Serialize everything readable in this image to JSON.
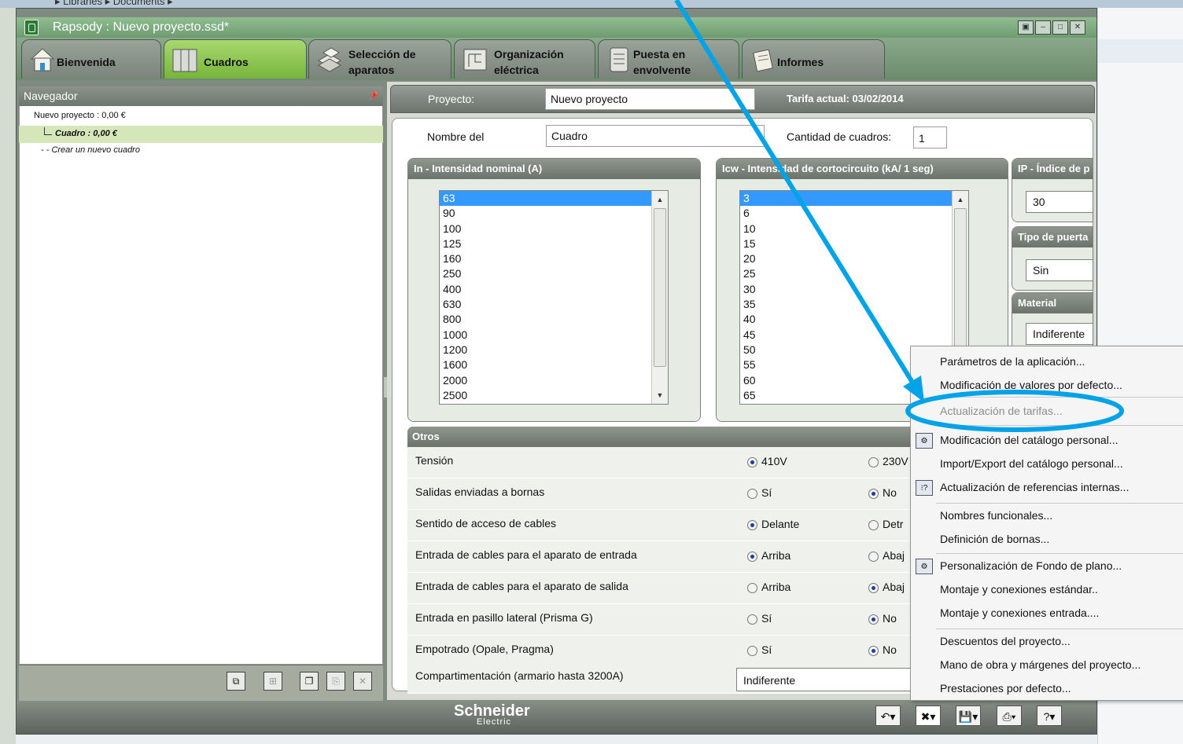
{
  "explorer_breadcrumb": "▸ Libraries ▸ Documents ▸",
  "window": {
    "title": "Rapsody : Nuevo proyecto.ssd*",
    "controls": [
      "restore",
      "minimize",
      "maximize",
      "close"
    ]
  },
  "tabs": [
    {
      "label": "Bienvenida",
      "icon": "house-icon"
    },
    {
      "label": "Cuadros",
      "icon": "cabinet-icon",
      "active": true
    },
    {
      "label1": "Selección de",
      "label2": "aparatos",
      "icon": "devices-icon"
    },
    {
      "label1": "Organización",
      "label2": "eléctrica",
      "icon": "electrical-org-icon"
    },
    {
      "label1": "Puesta en",
      "label2": "envolvente",
      "icon": "enclosure-icon"
    },
    {
      "label": "Informes",
      "icon": "reports-icon"
    }
  ],
  "navigator": {
    "header": "Navegador",
    "project": "Nuevo proyecto : 0,00 €",
    "cuadro": "Cuadro : 0,00 €",
    "new_cuadro": "Crear un nuevo cuadro"
  },
  "project_bar": {
    "label": "Proyecto:",
    "value": "Nuevo proyecto",
    "tariff": "Tarifa actual: 03/02/2014"
  },
  "form": {
    "name_label": "Nombre del",
    "name_value": "Cuadro",
    "qty_label": "Cantidad de cuadros:",
    "qty_value": "1"
  },
  "in_group": {
    "title": "In - Intensidad nominal (A)",
    "values": [
      "63",
      "90",
      "100",
      "125",
      "160",
      "250",
      "400",
      "630",
      "800",
      "1000",
      "1200",
      "1600",
      "2000",
      "2500"
    ],
    "selected": "63"
  },
  "icw_group": {
    "title": "Icw - Intensidad de cortocircuito (kA/ 1 seg)",
    "values": [
      "3",
      "6",
      "10",
      "15",
      "20",
      "25",
      "30",
      "35",
      "40",
      "45",
      "50",
      "55",
      "60",
      "65"
    ],
    "selected": "3"
  },
  "ip_group": {
    "title": "IP - Índice de p",
    "value": "30"
  },
  "door_group": {
    "title": "Tipo de puerta",
    "value": "Sin"
  },
  "material_group": {
    "title": "Material",
    "value": "Indiferente"
  },
  "otros": {
    "title": "Otros",
    "rows": [
      {
        "label": "Tensión",
        "opt1": "410V",
        "opt2": "230V",
        "selected": 1
      },
      {
        "label": "Salidas enviadas a bornas",
        "opt1": "Sí",
        "opt2": "No",
        "selected": 2
      },
      {
        "label": "Sentido de acceso de cables",
        "opt1": "Delante",
        "opt2": "Detr",
        "selected": 1
      },
      {
        "label": "Entrada de cables para el aparato de entrada",
        "opt1": "Arriba",
        "opt2": "Abaj",
        "selected": 1
      },
      {
        "label": "Entrada de cables para el aparato de salida",
        "opt1": "Arriba",
        "opt2": "Abaj",
        "selected": 2
      },
      {
        "label": "Entrada en pasillo lateral (Prisma G)",
        "opt1": "Sí",
        "opt2": "No",
        "selected": 2
      },
      {
        "label": "Empotrado (Opale, Pragma)",
        "opt1": "Sí",
        "opt2": "No",
        "selected": 2
      }
    ],
    "compart_label": "Compartimentación (armario hasta 3200A)",
    "compart_value": "Indiferente"
  },
  "footer": {
    "brand": "Schneider",
    "brand_sub": "Electric"
  },
  "menu": {
    "items": [
      {
        "label": "Parámetros de la aplicación..."
      },
      {
        "label": "Modificación de valores por defecto..."
      },
      {
        "label": "Actualización de tarifas...",
        "disabled": true
      },
      {
        "label": "Modificación del catálogo personal...",
        "icon": "catalog-icon"
      },
      {
        "label": "Import/Export del catálogo personal..."
      },
      {
        "label": "Actualización de referencias internas...",
        "icon": "references-icon"
      },
      {
        "label": "Nombres funcionales..."
      },
      {
        "label": "Definición de bornas..."
      },
      {
        "label": "Personalización de Fondo de plano...",
        "icon": "background-icon"
      },
      {
        "label": "Montaje y conexiones estándar.."
      },
      {
        "label": "Montaje y conexiones entrada...."
      },
      {
        "label": "Descuentos del proyecto..."
      },
      {
        "label": "Mano de obra y márgenes del proyecto..."
      },
      {
        "label": "Prestaciones por defecto..."
      }
    ]
  },
  "colors": {
    "accent_green": "#76b53b",
    "annotation_blue": "#00a3e8",
    "list_selection": "#3399ff"
  }
}
